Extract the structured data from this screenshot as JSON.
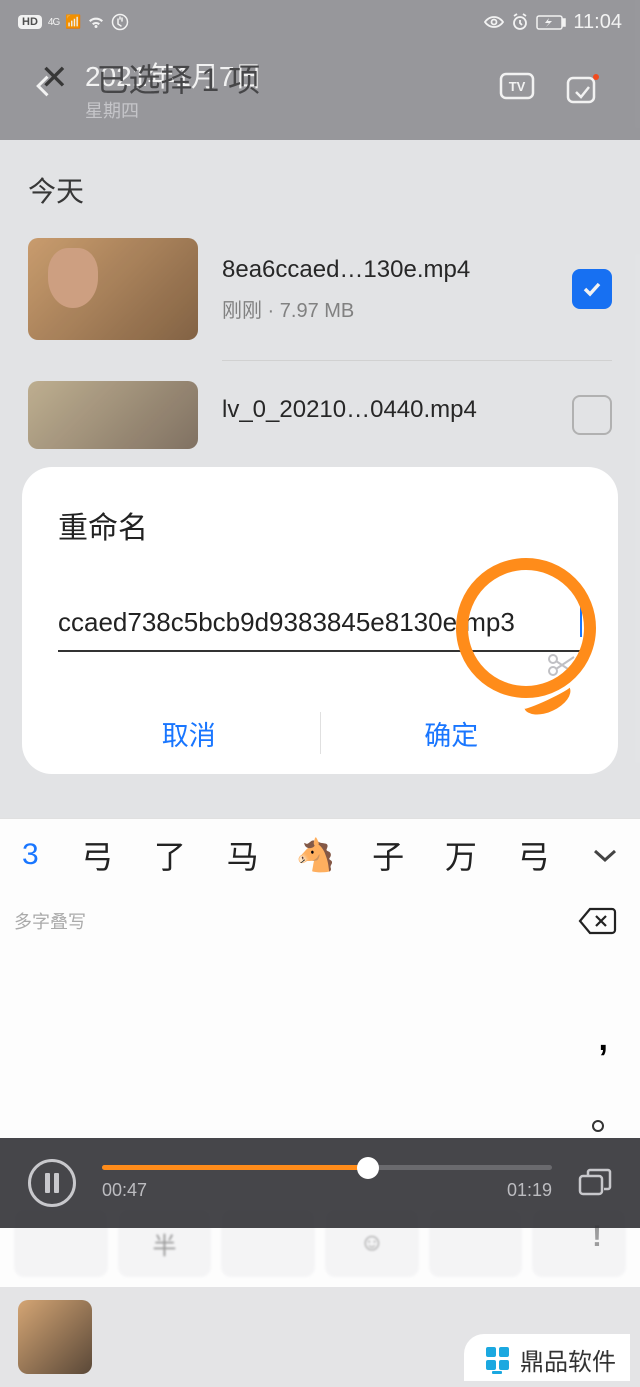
{
  "status": {
    "hd": "HD",
    "net": "4G",
    "time": "11:04"
  },
  "bg": {
    "date": "2021年1月7日",
    "day": "星期四"
  },
  "selection": {
    "title": "已选择 1 项"
  },
  "section": "今天",
  "files": [
    {
      "name": "8ea6ccaed…130e.mp4",
      "meta": "刚刚 · 7.97 MB",
      "checked": true
    },
    {
      "name": "lv_0_20210…0440.mp4",
      "meta": "",
      "checked": false
    }
  ],
  "dialog": {
    "title": "重命名",
    "value": "ccaed738c5bcb9d9383845e8130e.mp3",
    "cancel": "取消",
    "ok": "确定"
  },
  "keyboard": {
    "current": "3",
    "candidates": [
      "弓",
      "了",
      "马",
      "🐴",
      "子",
      "万",
      "弓"
    ],
    "hint": "多字叠写",
    "bottom_keys": [
      "",
      "半",
      "",
      "",
      "",
      ""
    ]
  },
  "player": {
    "elapsed": "00:47",
    "total": "01:19"
  },
  "watermark": "鼎品软件"
}
